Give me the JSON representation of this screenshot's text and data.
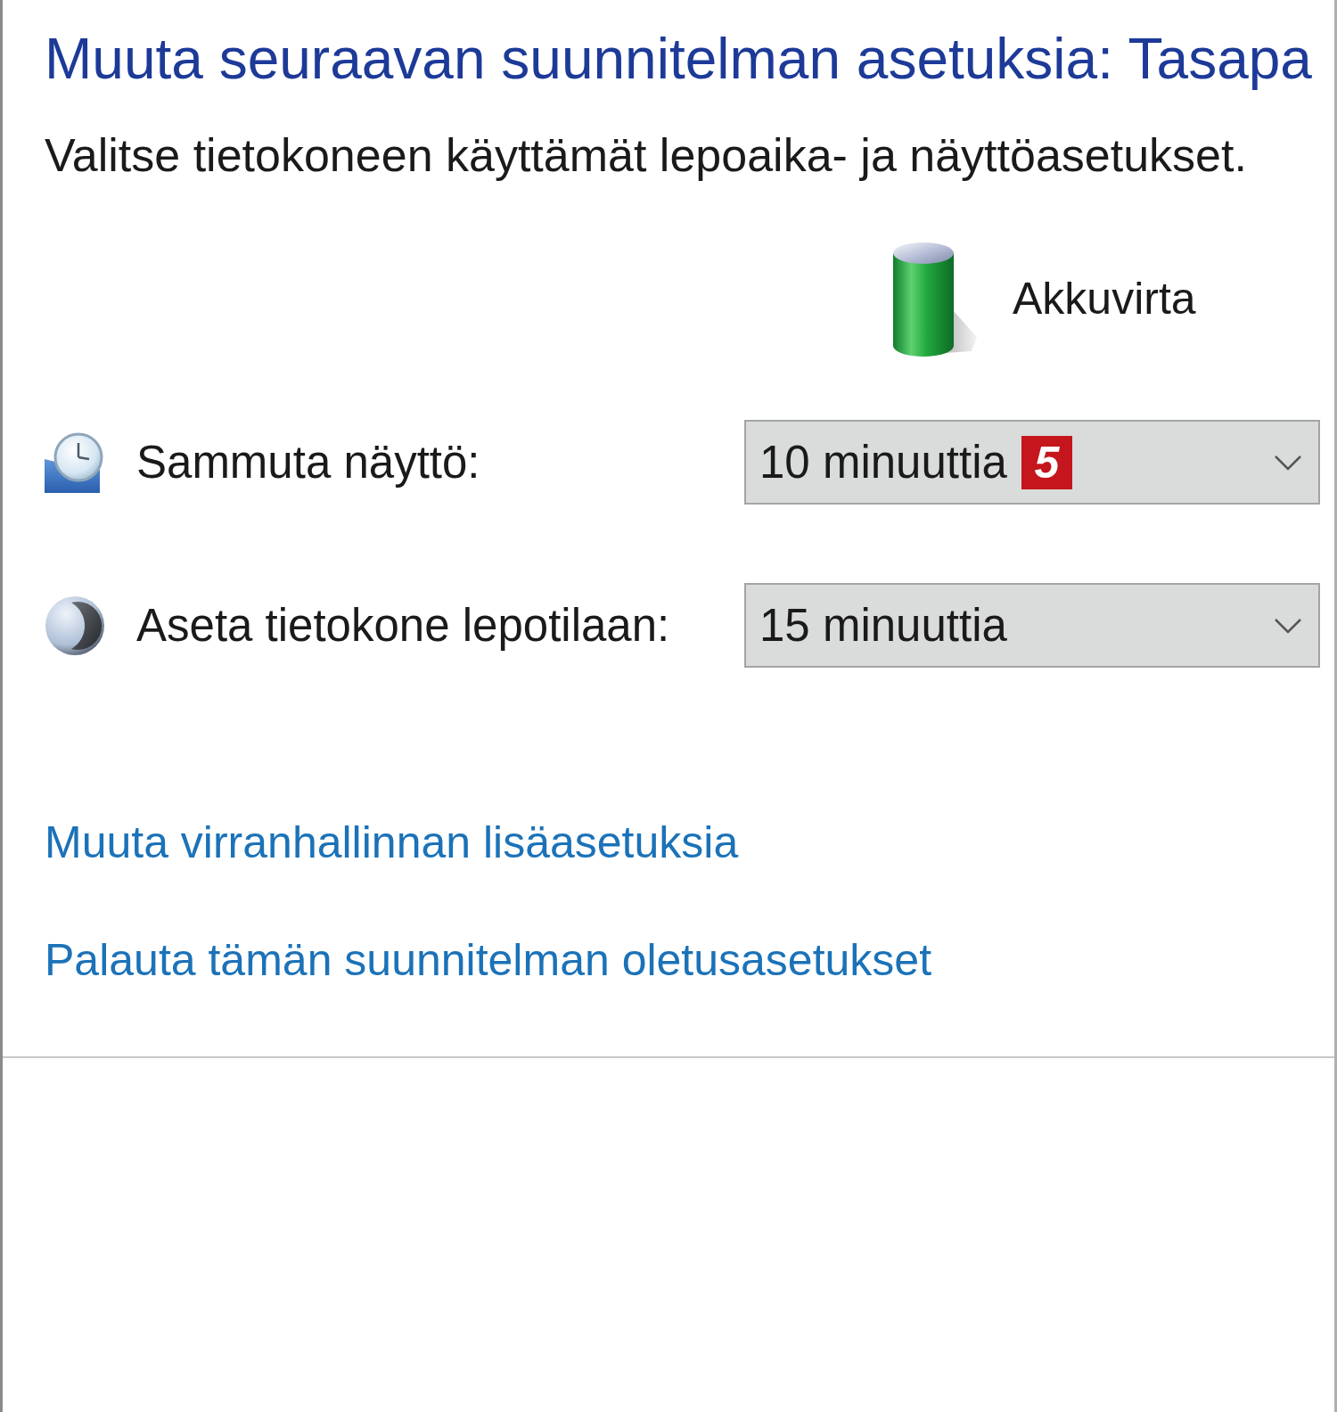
{
  "header": {
    "title": "Muuta seuraavan suunnitelman asetuksia: Tasapa",
    "subtitle": "Valitse tietokoneen käyttämät lepoaika- ja näyttöasetukset."
  },
  "power_source": {
    "label": "Akkuvirta"
  },
  "settings": [
    {
      "kind": "display",
      "label": "Sammuta näyttö:",
      "value": "10 minuuttia",
      "badge": "5"
    },
    {
      "kind": "sleep",
      "label": "Aseta tietokone lepotilaan:",
      "value": "15 minuuttia"
    }
  ],
  "links": [
    "Muuta virranhallinnan lisäasetuksia",
    "Palauta tämän suunnitelman oletusasetukset"
  ]
}
